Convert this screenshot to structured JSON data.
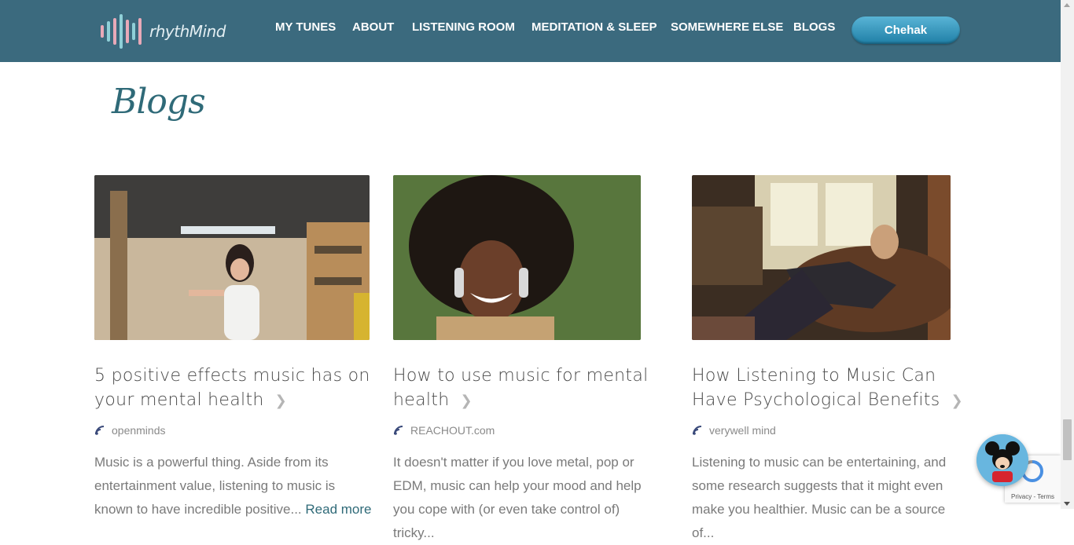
{
  "header": {
    "brand": "rhythMind",
    "nav": [
      "MY TUNES",
      "ABOUT",
      "LISTENING ROOM",
      "MEDITATION & SLEEP",
      "SOMEWHERE ELSE",
      "BLOGS"
    ],
    "user_button": "Chehak"
  },
  "page": {
    "title": "Blogs"
  },
  "cards": [
    {
      "title": "5 positive effects music has on your mental health",
      "source": "openminds",
      "excerpt": "Music is a powerful thing. Aside from its entertainment value, listening to music is known to have incredible positive...",
      "read_more": "Read more"
    },
    {
      "title": "How to use music for mental health",
      "source": "REACHOUT.com",
      "excerpt": "It doesn't matter if you love metal, pop or EDM, music can help your mood and help you cope with (or even take control of) tricky..."
    },
    {
      "title": "How Listening to Music Can Have Psychological Benefits",
      "source": "verywell mind",
      "excerpt": "Listening to music can be entertaining, and some research suggests that it might even make you healthier. Music can be a source of..."
    }
  ],
  "recaptcha": {
    "terms": "Privacy - Terms"
  },
  "colors": {
    "header": "#3b6a7e",
    "accent": "#2f6a78",
    "button": "#2b8fb8"
  },
  "icons": {
    "source": "source-icon",
    "chevron": "chevron-right-icon",
    "chat": "chat-avatar"
  }
}
